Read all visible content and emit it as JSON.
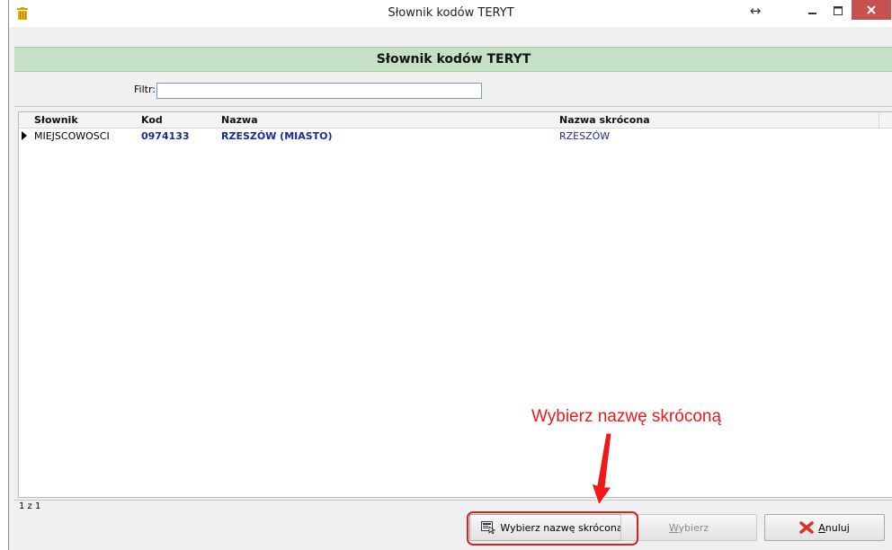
{
  "window": {
    "title": "Słownik kodów TERYT"
  },
  "header": {
    "title": "Słownik kodów TERYT"
  },
  "filter": {
    "label": "Filtr:",
    "value": ""
  },
  "grid": {
    "columns": [
      "Słownik",
      "Kod",
      "Nazwa",
      "Nazwa skrócona"
    ],
    "rows": [
      {
        "slownik": "MIEJSCOWOSCI",
        "kod": "0974133",
        "nazwa": "RZESZÓW (MIASTO)",
        "nazwa_skrocona": "RZESZÓW"
      }
    ]
  },
  "status": {
    "text": "1 z 1"
  },
  "buttons": {
    "select_short": "Wybierz nazwę skróconą",
    "select": "Wybierz",
    "cancel": "Anuluj"
  },
  "annotation": {
    "text": "Wybierz nazwę skróconą"
  },
  "colors": {
    "header_bg": "#c4e1c5",
    "link_text": "#1a2a9a",
    "close_button": "#c75050",
    "annotation": "#f01818"
  },
  "icons": {
    "app": "trash-bin-icon",
    "select_short": "form-select-icon",
    "cancel": "red-x-icon"
  }
}
